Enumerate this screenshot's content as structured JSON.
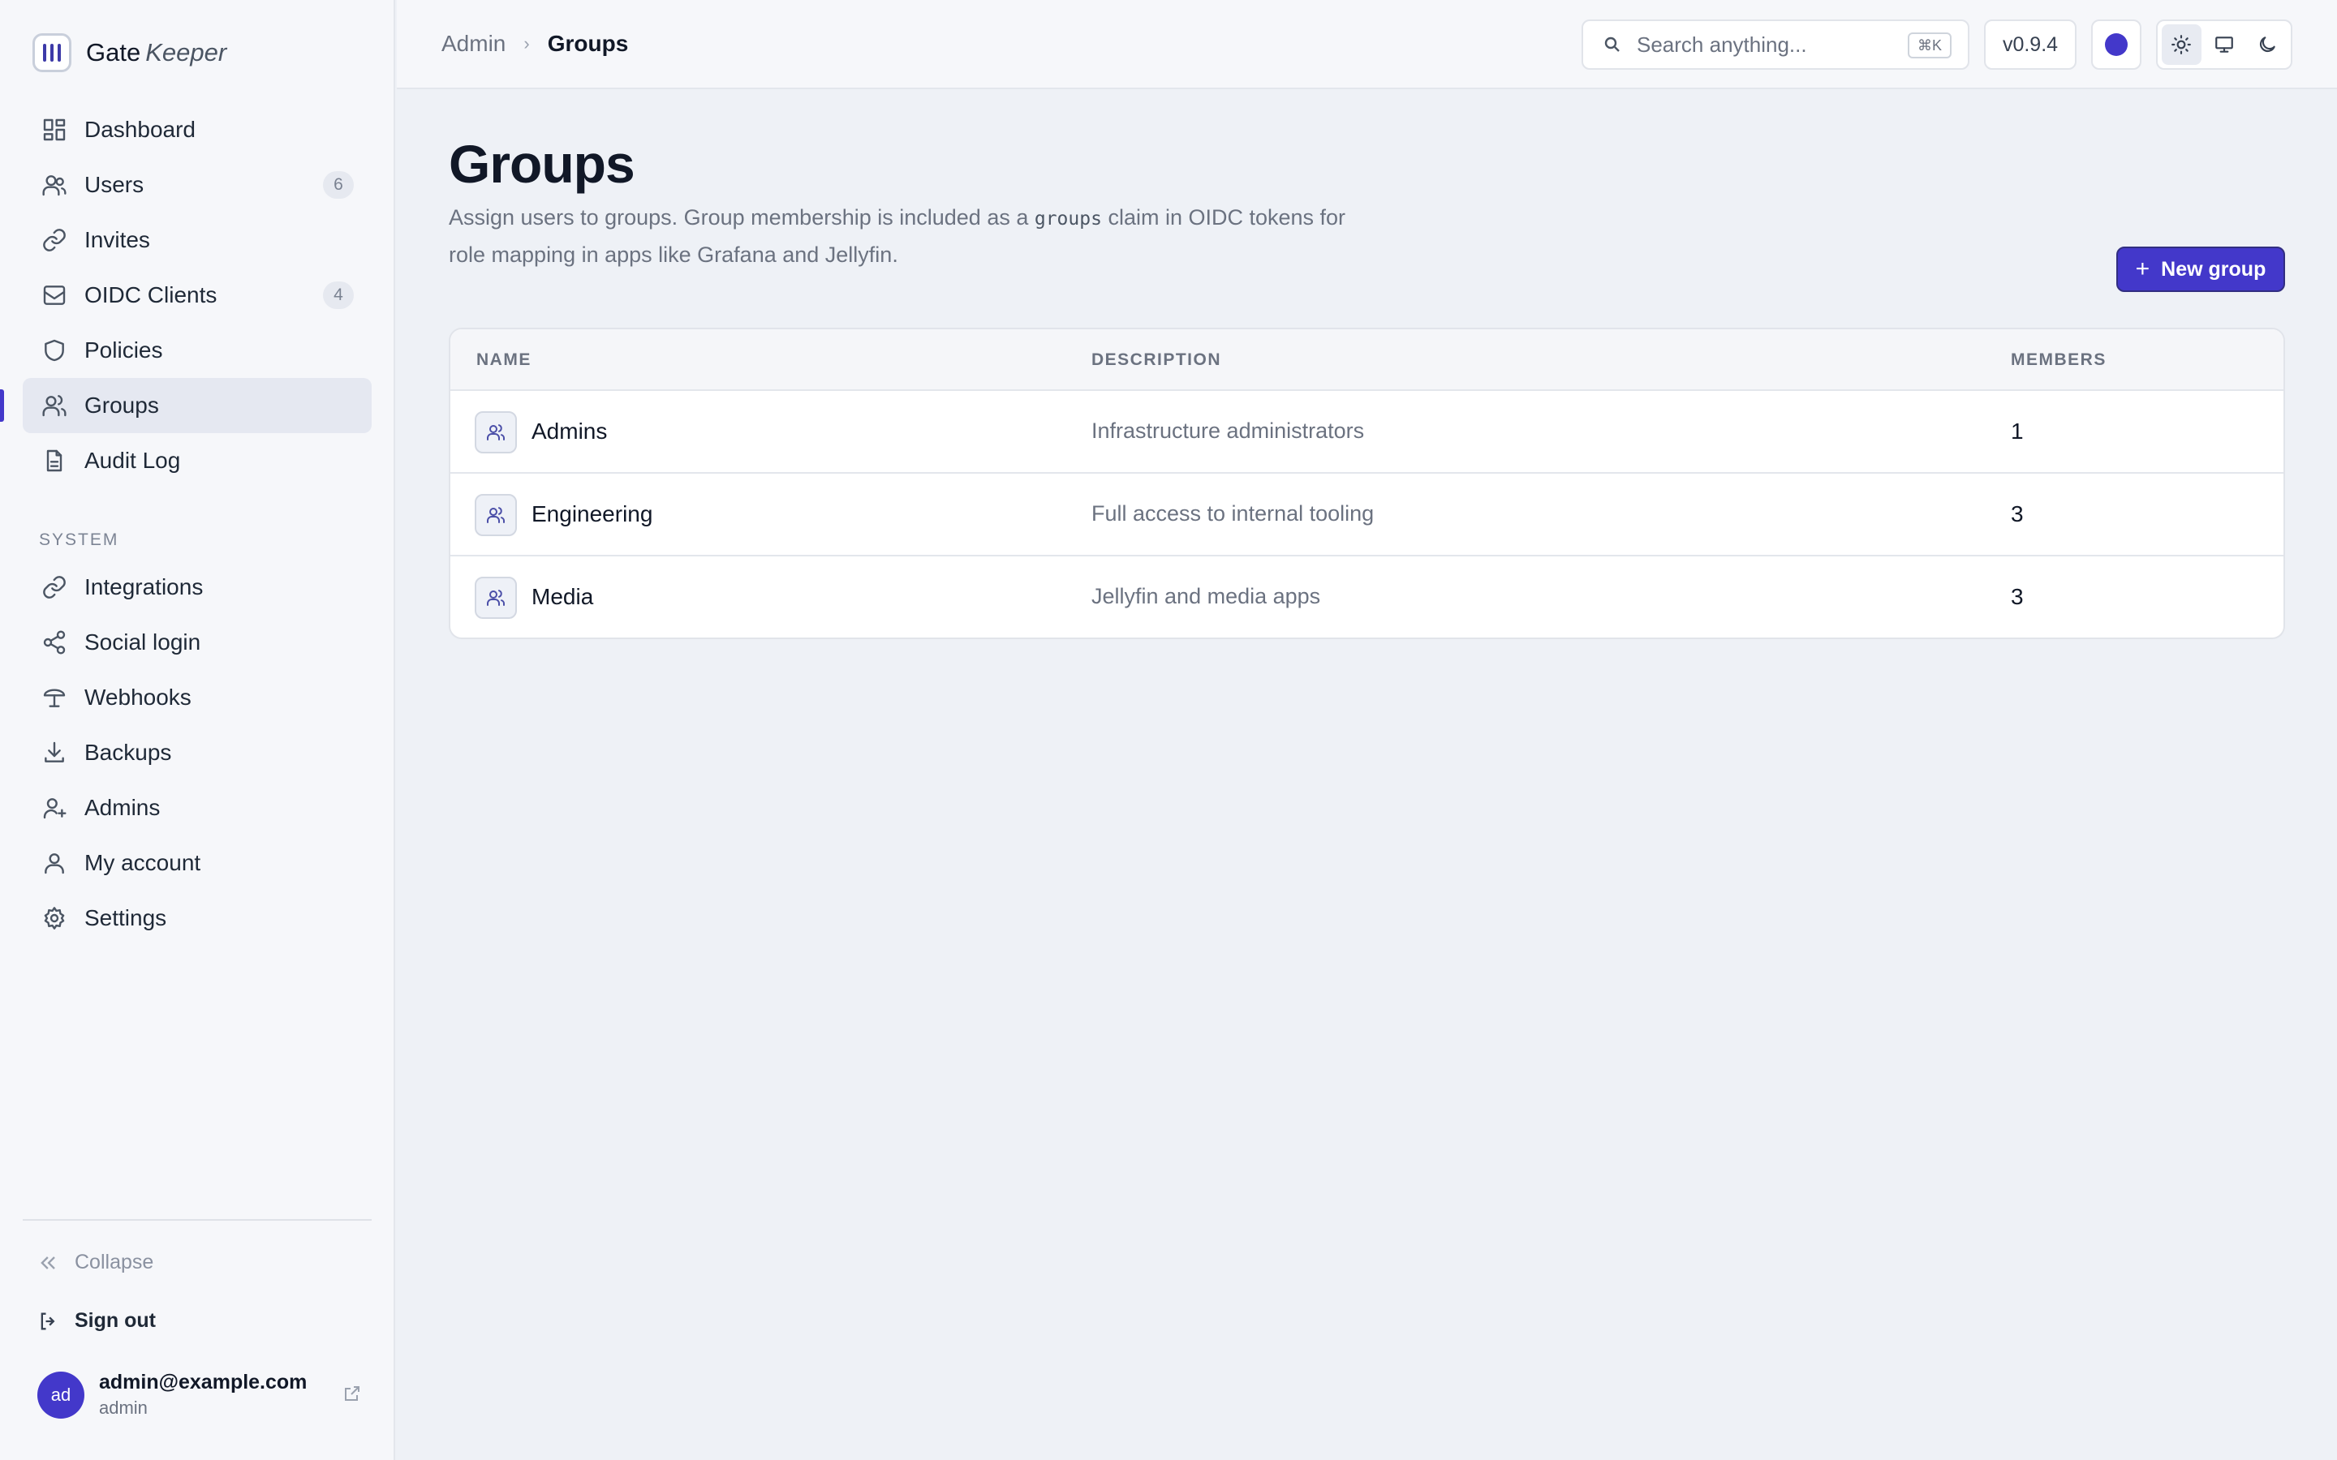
{
  "brand": {
    "name_a": "Gate",
    "name_b": "Keeper"
  },
  "sidebar": {
    "items": [
      {
        "label": "Dashboard",
        "icon": "grid-icon"
      },
      {
        "label": "Users",
        "icon": "users-icon",
        "badge": "6"
      },
      {
        "label": "Invites",
        "icon": "link-icon"
      },
      {
        "label": "OIDC Clients",
        "icon": "inbox-icon",
        "badge": "4"
      },
      {
        "label": "Policies",
        "icon": "shield-icon"
      },
      {
        "label": "Groups",
        "icon": "users-icon",
        "active": true
      },
      {
        "label": "Audit Log",
        "icon": "document-icon"
      }
    ],
    "system_label": "SYSTEM",
    "system_items": [
      {
        "label": "Integrations",
        "icon": "link-icon"
      },
      {
        "label": "Social login",
        "icon": "share-icon"
      },
      {
        "label": "Webhooks",
        "icon": "webhook-icon"
      },
      {
        "label": "Backups",
        "icon": "download-icon"
      },
      {
        "label": "Admins",
        "icon": "user-plus-icon"
      },
      {
        "label": "My account",
        "icon": "user-icon"
      },
      {
        "label": "Settings",
        "icon": "gear-icon"
      }
    ],
    "collapse_label": "Collapse",
    "signout_label": "Sign out",
    "user": {
      "initials": "ad",
      "email": "admin@example.com",
      "role": "admin"
    }
  },
  "header": {
    "breadcrumb_parent": "Admin",
    "breadcrumb_current": "Groups",
    "search_placeholder": "Search anything...",
    "search_shortcut": "⌘K",
    "version": "v0.9.4",
    "accent_color": "#4338ca",
    "theme_active": "light"
  },
  "main": {
    "title": "Groups",
    "desc_before": "Assign users to groups. Group membership is included as a ",
    "desc_code": "groups",
    "desc_after": " claim in OIDC tokens for role mapping in apps like Grafana and Jellyfin.",
    "new_button": "New group",
    "table": {
      "headers": {
        "name": "NAME",
        "description": "DESCRIPTION",
        "members": "MEMBERS"
      },
      "rows": [
        {
          "name": "Admins",
          "description": "Infrastructure administrators",
          "members": "1"
        },
        {
          "name": "Engineering",
          "description": "Full access to internal tooling",
          "members": "3"
        },
        {
          "name": "Media",
          "description": "Jellyfin and media apps",
          "members": "3"
        }
      ]
    }
  }
}
